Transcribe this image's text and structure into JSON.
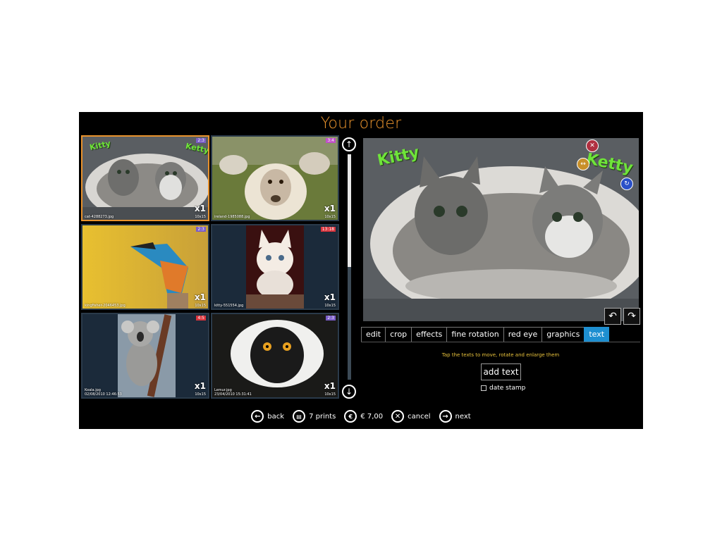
{
  "header": {
    "title": "Your order"
  },
  "thumbnails": [
    {
      "filename": "cat-4288273.jpg",
      "ratio": "2:3",
      "ratio_color": "#7a5cc8",
      "qty": "x1",
      "size": "10x15",
      "overlay_left": "Kitty",
      "overlay_right": "Ketty"
    },
    {
      "filename": "ireland-1985088.jpg",
      "ratio": "3:4",
      "ratio_color": "#c050c8",
      "qty": "x1",
      "size": "10x15"
    },
    {
      "filename": "kingfisher-2046453.jpg",
      "ratio": "2:3",
      "ratio_color": "#7a5cc8",
      "qty": "x1",
      "size": "10x15"
    },
    {
      "filename": "kitty-551554.jpg",
      "ratio": "13:18",
      "ratio_color": "#d8343c",
      "qty": "x1",
      "size": "10x15"
    },
    {
      "filename": "Koala.jpg",
      "date": "02/08/2010 12:46:53",
      "ratio": "4:5",
      "ratio_color": "#d8343c",
      "qty": "x1",
      "size": "10x15"
    },
    {
      "filename": "Lemur.jpg",
      "date": "23/04/2010 15:31:41",
      "ratio": "2:3",
      "ratio_color": "#7a5cc8",
      "qty": "x1",
      "size": "10x15"
    }
  ],
  "preview": {
    "text_left": "Kitty",
    "text_right": "Ketty"
  },
  "tabs": [
    {
      "label": "edit"
    },
    {
      "label": "crop"
    },
    {
      "label": "effects"
    },
    {
      "label": "fine rotation"
    },
    {
      "label": "red eye"
    },
    {
      "label": "graphics"
    },
    {
      "label": "text",
      "active": true
    }
  ],
  "text_panel": {
    "hint": "Tap the texts to move, rotate and enlarge them",
    "add_text": "add text",
    "date_stamp": "date stamp"
  },
  "bottombar": {
    "back": "back",
    "prints": "7 prints",
    "price": "€ 7,00",
    "cancel": "cancel",
    "next": "next"
  },
  "icons": [
    "arrow-up-icon",
    "arrow-down-icon",
    "rotate-left-icon",
    "rotate-right-icon",
    "delete-icon",
    "resize-icon",
    "rotate-handle-icon",
    "back-icon",
    "prints-icon",
    "price-icon",
    "cancel-icon",
    "next-icon"
  ]
}
